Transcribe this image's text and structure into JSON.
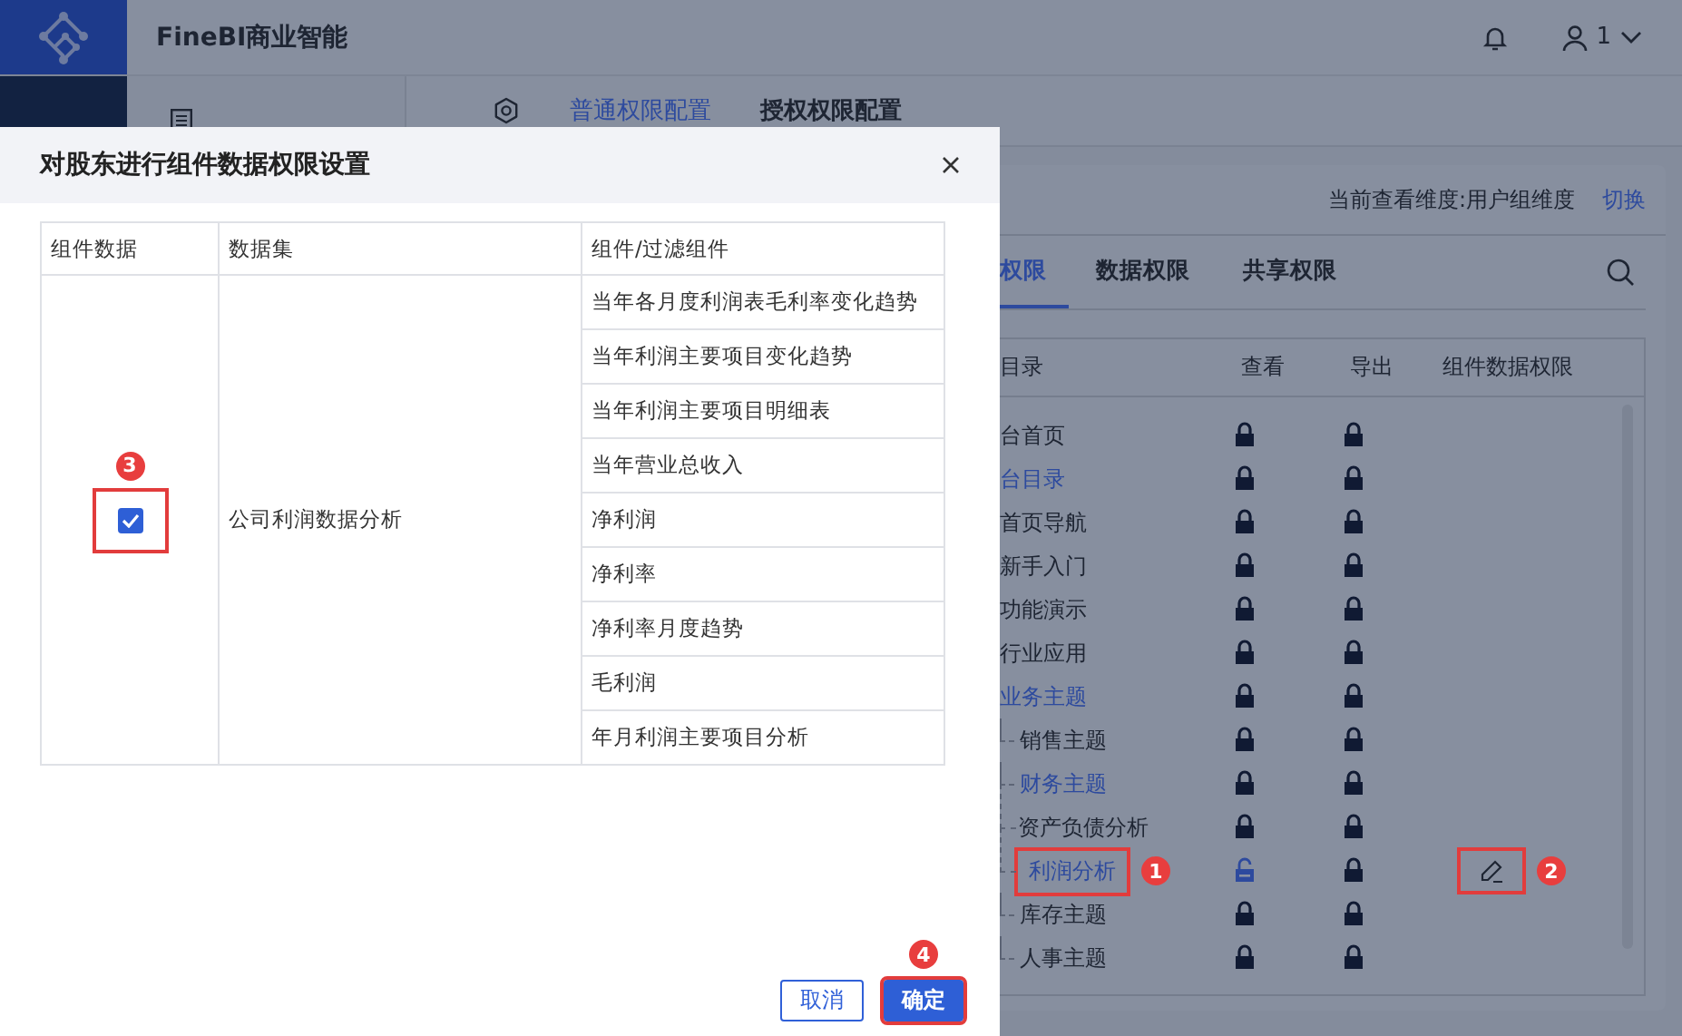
{
  "header": {
    "product": "FineBI商业智能",
    "user": "1"
  },
  "config_tabs": [
    {
      "label": "普通权限配置",
      "selected": true
    },
    {
      "label": "授权权限配置",
      "selected": false
    }
  ],
  "dimension": {
    "label": "当前查看维度:用户组维度",
    "action": "切换"
  },
  "permission_tabs": [
    {
      "label": "权限",
      "selected": true
    },
    {
      "label": "数据权限",
      "selected": false
    },
    {
      "label": "共享权限",
      "selected": false
    }
  ],
  "permission_table": {
    "columns": [
      "目录",
      "查看",
      "导出",
      "组件数据权限"
    ],
    "rows": [
      {
        "name": "台首页",
        "kind": "text",
        "view_locked": true,
        "export_locked": true
      },
      {
        "name": "台目录",
        "kind": "link",
        "view_locked": true,
        "export_locked": true
      },
      {
        "name": "首页导航",
        "kind": "text",
        "view_locked": true,
        "export_locked": true
      },
      {
        "name": "新手入门",
        "kind": "text",
        "view_locked": true,
        "export_locked": true
      },
      {
        "name": "功能演示",
        "kind": "text",
        "view_locked": true,
        "export_locked": true
      },
      {
        "name": "行业应用",
        "kind": "text",
        "view_locked": true,
        "export_locked": true
      },
      {
        "name": "业务主题",
        "kind": "link",
        "view_locked": true,
        "export_locked": true,
        "children": [
          {
            "name": "销售主题",
            "kind": "text",
            "view_locked": true,
            "export_locked": true
          },
          {
            "name": "财务主题",
            "kind": "link",
            "view_locked": true,
            "export_locked": true,
            "children": [
              {
                "name": "资产负债分析",
                "kind": "text",
                "view_locked": true,
                "export_locked": true
              },
              {
                "name": "利润分析",
                "kind": "link",
                "view_locked": false,
                "export_locked": true,
                "callout": "1",
                "edit_callout": "2"
              }
            ]
          },
          {
            "name": "库存主题",
            "kind": "text",
            "view_locked": true,
            "export_locked": true
          },
          {
            "name": "人事主题",
            "kind": "text",
            "view_locked": true,
            "export_locked": true
          }
        ]
      }
    ]
  },
  "dialog": {
    "title": "对股东进行组件数据权限设置",
    "columns": [
      "组件数据",
      "数据集",
      "组件/过滤组件"
    ],
    "groups": [
      {
        "checked": true,
        "callout": "3",
        "dataset": "公司利润数据分析",
        "components": [
          "当年各月度利润表毛利率变化趋势",
          "当年利润主要项目变化趋势",
          "当年利润主要项目明细表",
          "当年营业总收入",
          "净利润",
          "净利率",
          "净利率月度趋势",
          "毛利润",
          "年月利润主要项目分析"
        ]
      }
    ],
    "buttons": [
      {
        "label": "取消",
        "kind": "secondary"
      },
      {
        "label": "确定",
        "kind": "primary",
        "callout": "4"
      }
    ]
  }
}
